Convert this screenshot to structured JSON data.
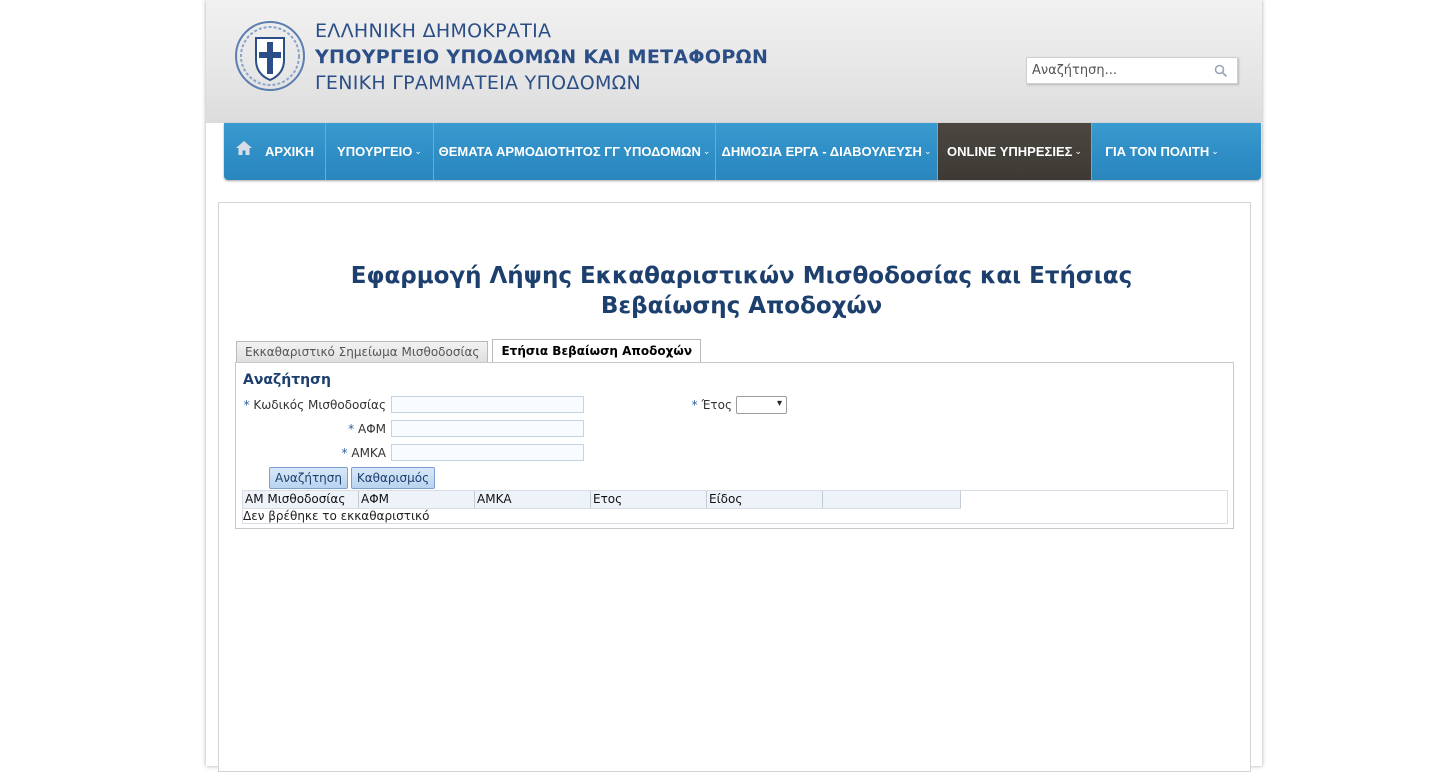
{
  "header": {
    "line1": "ΕΛΛΗΝΙΚΗ ΔΗΜΟΚΡΑΤΙΑ",
    "line2": "ΥΠΟΥΡΓΕΙΟ ΥΠΟΔΟΜΩΝ ΚΑΙ ΜΕΤΑΦΟΡΩΝ",
    "line3": "ΓΕΝΙΚΗ ΓΡΑΜΜΑΤΕΙΑ ΥΠΟΔΟΜΩΝ",
    "search_placeholder": "Αναζήτηση..."
  },
  "nav": {
    "items": [
      {
        "label": "ΑΡΧΙΚΗ"
      },
      {
        "label": "ΥΠΟΥΡΓΕΙΟ"
      },
      {
        "label": "ΘΕΜΑΤΑ ΑΡΜΟΔΙΟΤΗΤΟΣ ΓΓ ΥΠΟΔΟΜΩΝ"
      },
      {
        "label": "ΔΗΜΟΣΙΑ ΕΡΓΑ - ΔΙΑΒΟΥΛΕΥΣΗ"
      },
      {
        "label": "ONLINE ΥΠΗΡΕΣΙΕΣ"
      },
      {
        "label": "ΓΙΑ ΤΟΝ ΠΟΛΙΤΗ"
      }
    ],
    "active": "ONLINE ΥΠΗΡΕΣΙΕΣ"
  },
  "main": {
    "title": "Εφαρμογή Λήψης Εκκαθαριστικών Μισθοδοσίας και Ετήσιας Βεβαίωσης Αποδοχών",
    "tabs": [
      {
        "label": "Εκκαθαριστικό Σημείωμα Μισθοδοσίας",
        "selected": false
      },
      {
        "label": "Ετήσια Βεβαίωση Αποδοχών",
        "selected": true
      }
    ],
    "section_title": "Αναζήτηση",
    "form": {
      "required_mark": "*",
      "payroll_code_label": "Κωδικός Μισθοδοσίας",
      "year_label": "Έτος",
      "afm_label": "ΑΦΜ",
      "amka_label": "ΑΜΚΑ",
      "payroll_code_value": "",
      "afm_value": "",
      "amka_value": "",
      "year_value": ""
    },
    "buttons": {
      "search": "Αναζήτηση",
      "clear": "Καθαρισμός"
    },
    "results": {
      "columns": [
        "ΑΜ Μισθοδοσίας",
        "ΑΦΜ",
        "ΑΜΚΑ",
        "Ετος",
        "Είδος",
        ""
      ],
      "empty_message": "Δεν βρέθηκε το εκκαθαριστικό"
    }
  },
  "colors": {
    "nav_blue": "#2f8fc6",
    "nav_active": "#45413b",
    "title_blue": "#1d3f6e",
    "header_text": "#2b4e86"
  }
}
